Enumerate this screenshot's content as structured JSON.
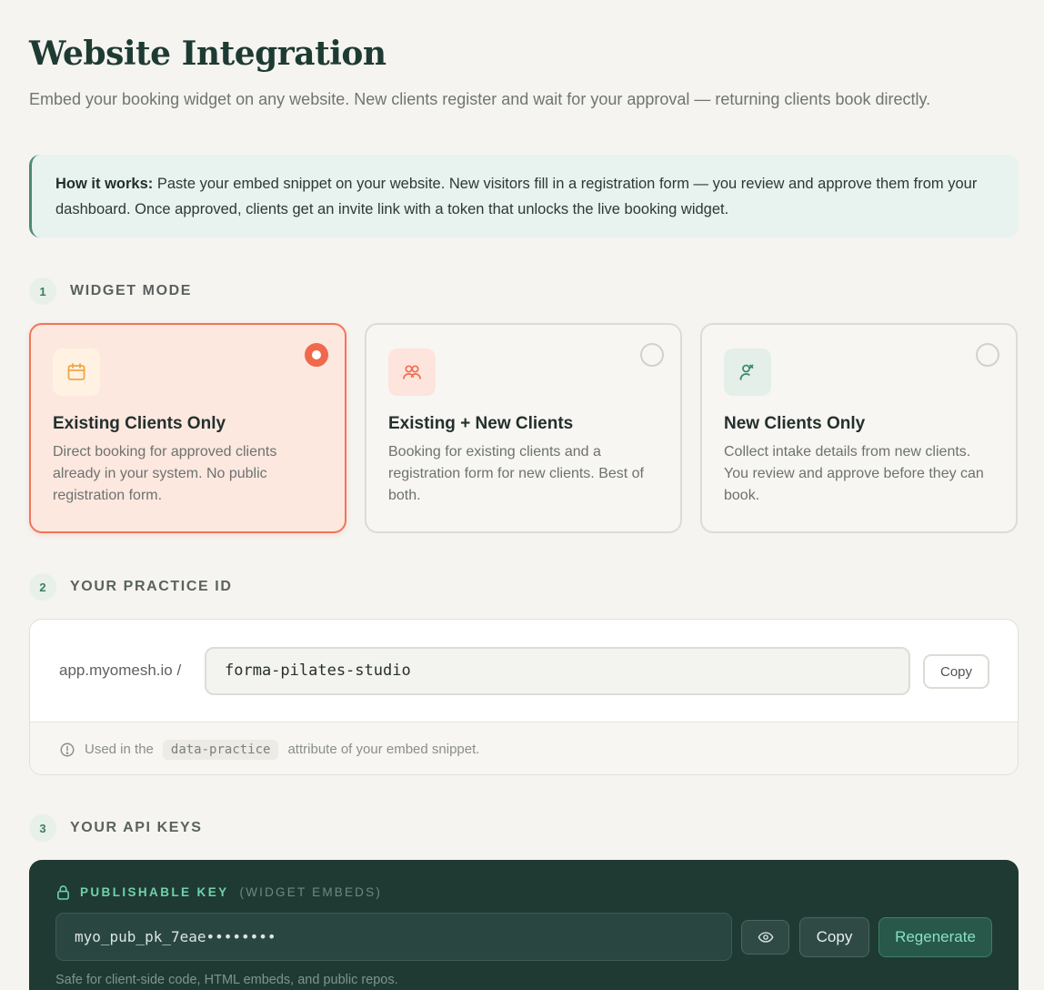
{
  "header": {
    "title": "Website Integration",
    "subtitle": "Embed your booking widget on any website. New clients register and wait for your approval — returning clients book directly."
  },
  "info_box": {
    "lead": "How it works:",
    "text": " Paste your embed snippet on your website. New visitors fill in a registration form — you review and approve them from your dashboard. Once approved, clients get an invite link with a token that unlocks the live booking widget."
  },
  "steps": [
    {
      "number": "1",
      "label": "WIDGET MODE"
    },
    {
      "number": "2",
      "label": "YOUR PRACTICE ID"
    },
    {
      "number": "3",
      "label": "YOUR API KEYS"
    }
  ],
  "modes": [
    {
      "icon": "calendar-icon",
      "title": "Existing Clients Only",
      "description": "Direct booking for approved clients already in your system. No public registration form.",
      "selected": true
    },
    {
      "icon": "users-icon",
      "title": "Existing + New Clients",
      "description": "Booking for existing clients and a registration form for new clients. Best of both.",
      "selected": false
    },
    {
      "icon": "user-plus-icon",
      "title": "New Clients Only",
      "description": "Collect intake details from new clients. You review and approve before they can book.",
      "selected": false
    }
  ],
  "practice": {
    "prefix": "app.myomesh.io /",
    "value": "forma-pilates-studio",
    "copy_label": "Copy",
    "note_before": "Used in the",
    "note_code": "data-practice",
    "note_after": "attribute of your embed snippet."
  },
  "api_keys": {
    "label": "PUBLISHABLE KEY",
    "sublabel": "(WIDGET EMBEDS)",
    "value": "myo_pub_pk_7eae••••••••",
    "copy_label": "Copy",
    "regenerate_label": "Regenerate",
    "help": "Safe for client-side code, HTML embeds, and public repos."
  },
  "colors": {
    "accent": "#f0694d",
    "brand_dark": "#1f3a33",
    "key_accent": "#6fd2ac"
  }
}
